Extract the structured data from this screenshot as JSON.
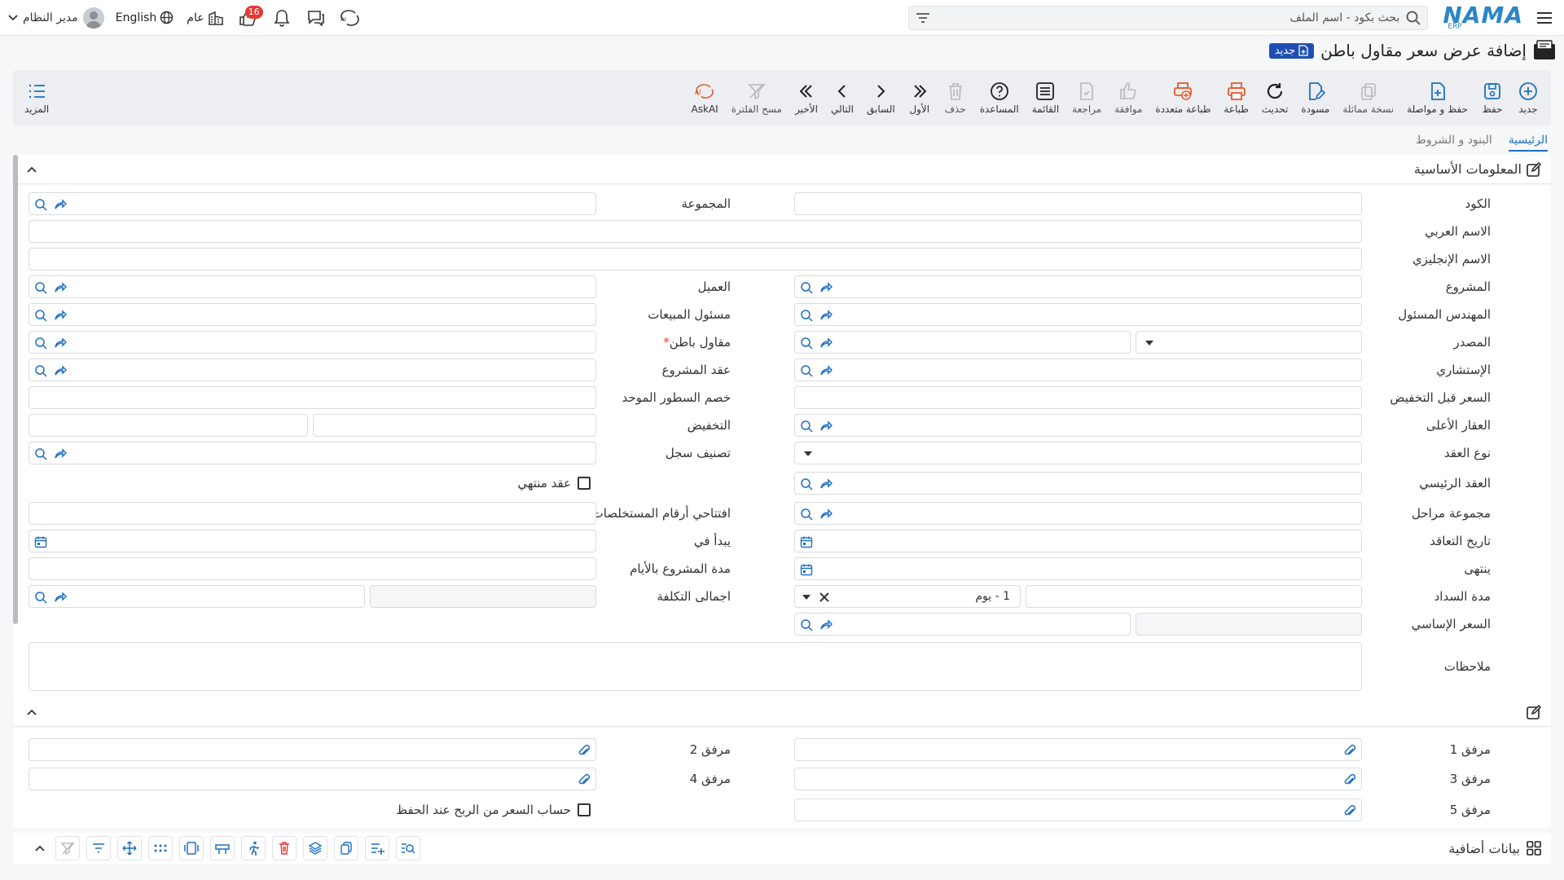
{
  "topbar": {
    "logo_text": "NAMA",
    "logo_sub": "ERP",
    "search_placeholder": "بحث بكود - اسم الملف",
    "notifications_count": "16",
    "general_label": "عام",
    "language_label": "English",
    "user_label": "مدير النظام"
  },
  "page": {
    "title": "إضافة عرض سعر مقاول باطن",
    "new_badge": "جديد"
  },
  "toolbar": {
    "items": [
      {
        "label": "جديد",
        "icon": "plus-circle-icon"
      },
      {
        "label": "حفظ",
        "icon": "save-icon"
      },
      {
        "label": "حفظ و مواصلة",
        "icon": "save-continue-icon"
      },
      {
        "label": "نسخة مماثلة",
        "icon": "copy-icon"
      },
      {
        "label": "مسودة",
        "icon": "draft-icon"
      },
      {
        "label": "تحديث",
        "icon": "refresh-icon"
      },
      {
        "label": "طباعة",
        "icon": "print-icon"
      },
      {
        "label": "طباعة متعددة",
        "icon": "multi-print-icon"
      },
      {
        "label": "موافقة",
        "icon": "thumbs-up-icon"
      },
      {
        "label": "مراجعة",
        "icon": "review-icon"
      },
      {
        "label": "القائمة",
        "icon": "list-icon"
      },
      {
        "label": "المساعدة",
        "icon": "help-icon"
      },
      {
        "label": "حذف",
        "icon": "trash-icon"
      },
      {
        "label": "الأول",
        "icon": "first-icon"
      },
      {
        "label": "السابق",
        "icon": "previous-icon"
      },
      {
        "label": "التالي",
        "icon": "next-icon"
      },
      {
        "label": "الأخير",
        "icon": "last-icon"
      },
      {
        "label": "مسح الفلترة",
        "icon": "clear-filter-icon"
      },
      {
        "label": "AskAI",
        "icon": "ask-ai-icon"
      }
    ],
    "more_label": "المزيد"
  },
  "tabs": [
    {
      "label": "الرئيسية",
      "active": true
    },
    {
      "label": "البنود و الشروط",
      "active": false
    }
  ],
  "section_basic": {
    "title": "المعلومات الأساسية"
  },
  "fields": {
    "code": "الكود",
    "group": "المجموعة",
    "arabic_name": "الاسم العربي",
    "english_name": "الاسم الإنجليزي",
    "project": "المشروع",
    "customer": "العميل",
    "engineer": "المهندس المسئول",
    "sales_rep": "مسئول المبيعات",
    "source": "المصدر",
    "subcontractor": "مقاول باطن",
    "required_mark": "*",
    "consultant": "الإستشاري",
    "project_contract": "عقد المشروع",
    "price_before_discount": "السعر قبل التخفيض",
    "unified_line_discount": "خصم السطور الموحد",
    "parent_property": "العقار الأعلى",
    "discount": "التخفيض",
    "contract_type": "نوع العقد",
    "record_class": "تصنيف سجل",
    "main_contract": "العقد الرئيسي",
    "contract_ended": "عقد منتهي",
    "stage_group": "مجموعة مراحل",
    "opening_extract_numbers": "افتتاحي أرقام المستخلصات",
    "contract_date": "تاريخ التعاقد",
    "starts_at": "يبدأ في",
    "ends": "ينتهى",
    "duration_days": "مدة المشروع بالأيام",
    "payment_period": "مدة السداد",
    "payment_unit_value": "1 - يوم",
    "total_cost": "اجمالى التكلفة",
    "base_price": "السعر الإساسي",
    "notes": "ملاحظات"
  },
  "attachments": {
    "a1": "مرفق 1",
    "a2": "مرفق 2",
    "a3": "مرفق 3",
    "a4": "مرفق 4",
    "a5": "مرفق 5",
    "calc_price": "حساب السعر من الربح عند الحفظ"
  },
  "bottom": {
    "extra_data": "بيانات أضافية"
  },
  "colors": {
    "accent": "#1e6fc2",
    "danger": "#e53935",
    "print": "#e8592b"
  }
}
